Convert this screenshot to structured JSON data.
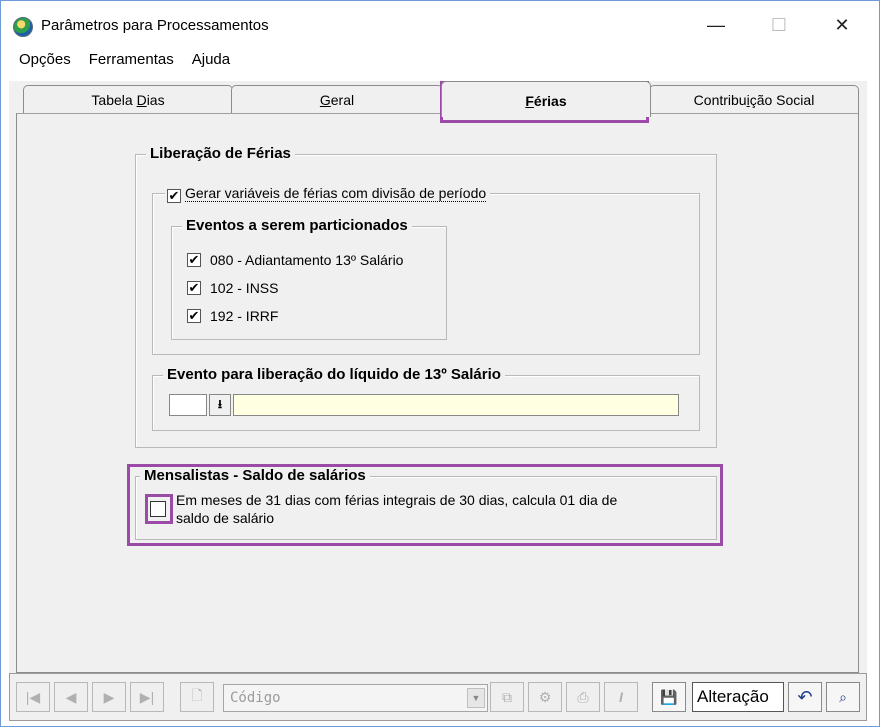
{
  "window": {
    "title": "Parâmetros para Processamentos",
    "controls": {
      "minimize": "—",
      "maximize": "☐",
      "close": "✕"
    }
  },
  "menu": {
    "items": [
      "Opções",
      "Ferramentas",
      "Ajuda"
    ]
  },
  "tabs": [
    {
      "label_prefix": "Tabela ",
      "label_ul": "D",
      "label_suffix": "ias",
      "active": false
    },
    {
      "label_prefix": "",
      "label_ul": "G",
      "label_suffix": "eral",
      "active": false
    },
    {
      "label_prefix": "",
      "label_ul": "F",
      "label_suffix": "érias",
      "active": true
    },
    {
      "label_prefix": "Contribu",
      "label_ul": "i",
      "label_suffix": "ção Social",
      "active": false
    }
  ],
  "ferias": {
    "group_title": "Liberação de Férias",
    "split_checkbox": {
      "label": "Gerar variáveis de férias com divisão de período",
      "checked": true
    },
    "eventos": {
      "title": "Eventos a serem particionados",
      "items": [
        {
          "label": "080 - Adiantamento 13º Salário",
          "checked": true
        },
        {
          "label": "102 - INSS",
          "checked": true
        },
        {
          "label": "192 - IRRF",
          "checked": true
        }
      ]
    },
    "evento_liquido": {
      "title": "Evento para liberação do líquido de 13º Salário",
      "code_value": "",
      "description_value": "",
      "lookup_icon": "download-arrow-icon"
    }
  },
  "mensalistas": {
    "title": "Mensalistas - Saldo de salários",
    "checkbox_label_line1": "Em meses de 31 dias com férias integrais de 30 dias, calcula 01 dia de",
    "checkbox_label_line2": "saldo de salário",
    "checked": false
  },
  "toolbar": {
    "first": "|◀",
    "prev": "◀",
    "next": "▶",
    "last": "▶|",
    "combo_placeholder": "Código",
    "mode": "Alteração",
    "italic": "I",
    "undo_icon": "↶",
    "find_icon": "binoculars-icon"
  },
  "colors": {
    "highlight": "#9b4aa8",
    "lookup_field": "#ffffe1"
  }
}
